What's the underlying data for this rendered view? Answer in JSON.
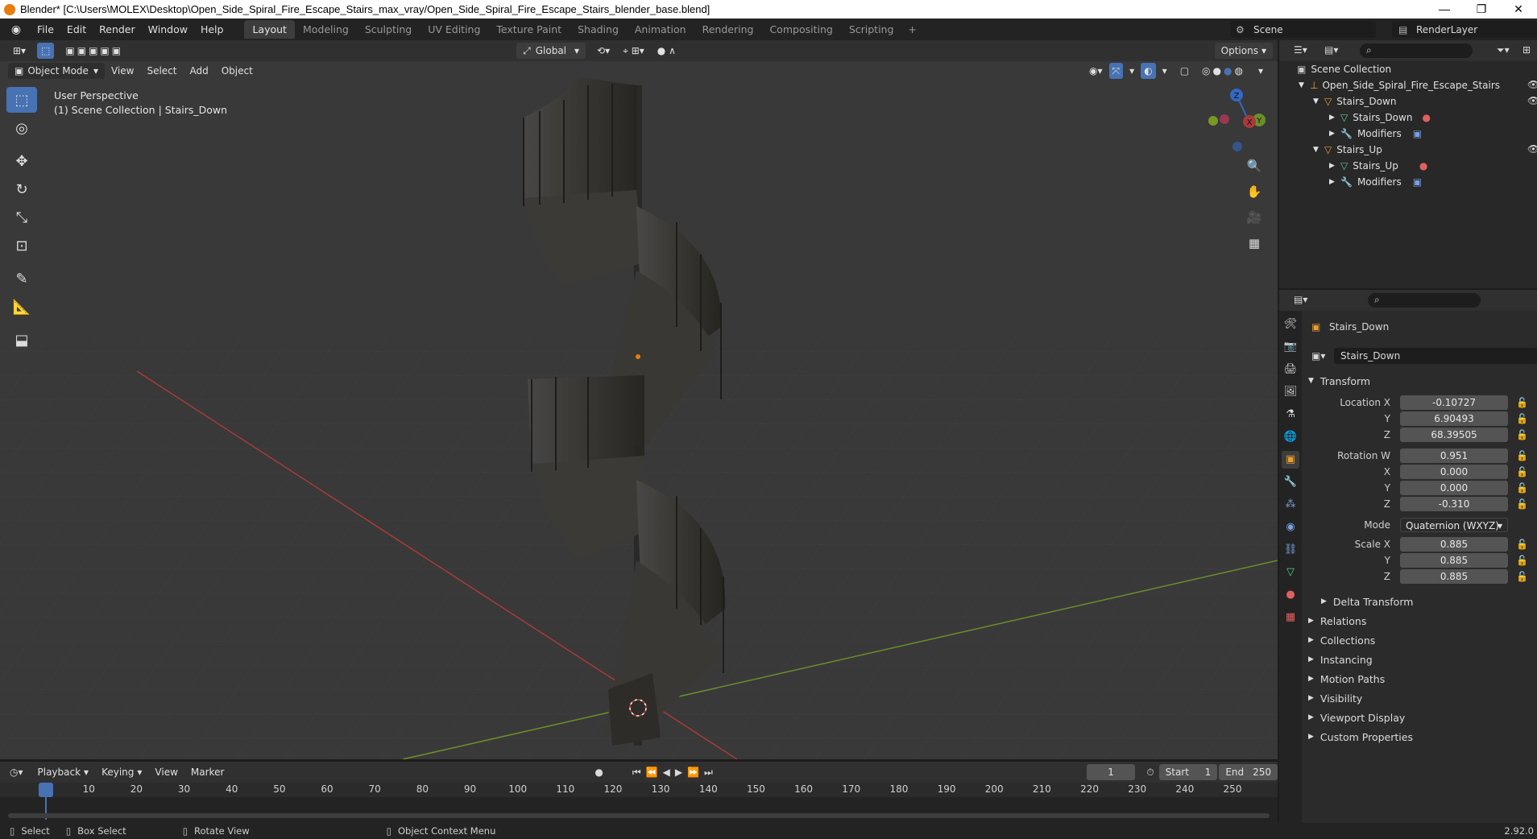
{
  "window": {
    "title": "Blender* [C:\\Users\\MOLEX\\Desktop\\Open_Side_Spiral_Fire_Escape_Stairs_max_vray/Open_Side_Spiral_Fire_Escape_Stairs_blender_base.blend]"
  },
  "menu": [
    "File",
    "Edit",
    "Render",
    "Window",
    "Help"
  ],
  "workspaces": [
    "Layout",
    "Modeling",
    "Sculpting",
    "UV Editing",
    "Texture Paint",
    "Shading",
    "Animation",
    "Rendering",
    "Compositing",
    "Scripting"
  ],
  "scene": "Scene",
  "render_layer": "RenderLayer",
  "viewport_header": {
    "orientation": "Global",
    "options": "Options"
  },
  "viewport_menu": {
    "mode": "Object Mode",
    "items": [
      "View",
      "Select",
      "Add",
      "Object"
    ]
  },
  "viewport_info": {
    "line1": "User Perspective",
    "line2": "(1) Scene Collection | Stairs_Down"
  },
  "gizmo": {
    "z": "Z",
    "y": "Y",
    "x": "X"
  },
  "outliner": {
    "root": "Scene Collection",
    "items": [
      {
        "label": "Open_Side_Spiral_Fire_Escape_Stairs",
        "level": 1
      },
      {
        "label": "Stairs_Down",
        "level": 2
      },
      {
        "label": "Stairs_Down",
        "level": 3
      },
      {
        "label": "Modifiers",
        "level": 3
      },
      {
        "label": "Stairs_Up",
        "level": 2
      },
      {
        "label": "Stairs_Up",
        "level": 3
      },
      {
        "label": "Modifiers",
        "level": 3
      }
    ]
  },
  "properties": {
    "object_name": "Stairs_Down",
    "data_name": "Stairs_Down",
    "transform_label": "Transform",
    "location": {
      "label": "Location X",
      "x": "-0.10727",
      "y": "6.90493",
      "z": "68.39505"
    },
    "rotation": {
      "label": "Rotation W",
      "w": "0.951",
      "x": "0.000",
      "y": "0.000",
      "z": "-0.310"
    },
    "mode": {
      "label": "Mode",
      "value": "Quaternion (WXYZ)"
    },
    "scale": {
      "label": "Scale X",
      "x": "0.885",
      "y": "0.885",
      "z": "0.885"
    },
    "axis": {
      "x": "X",
      "y": "Y",
      "z": "Z"
    },
    "delta": "Delta Transform",
    "panels": [
      "Relations",
      "Collections",
      "Instancing",
      "Motion Paths",
      "Visibility",
      "Viewport Display",
      "Custom Properties"
    ]
  },
  "timeline": {
    "menus": [
      "Playback",
      "Keying",
      "View",
      "Marker"
    ],
    "current_frame": "1",
    "start_label": "Start",
    "start": "1",
    "end_label": "End",
    "end": "250",
    "ruler": [
      "1",
      "10",
      "20",
      "30",
      "40",
      "50",
      "60",
      "70",
      "80",
      "90",
      "100",
      "110",
      "120",
      "130",
      "140",
      "150",
      "160",
      "170",
      "180",
      "190",
      "200",
      "210",
      "220",
      "230",
      "240",
      "250"
    ]
  },
  "status": {
    "select": "Select",
    "box_select": "Box Select",
    "rotate": "Rotate View",
    "context": "Object Context Menu",
    "version": "2.92.0"
  },
  "colors": {
    "accent": "#4772b3",
    "x_axis": "#a93a3a",
    "y_axis": "#6a8f2a",
    "z_axis": "#3568c4",
    "orange": "#e87d0d"
  }
}
